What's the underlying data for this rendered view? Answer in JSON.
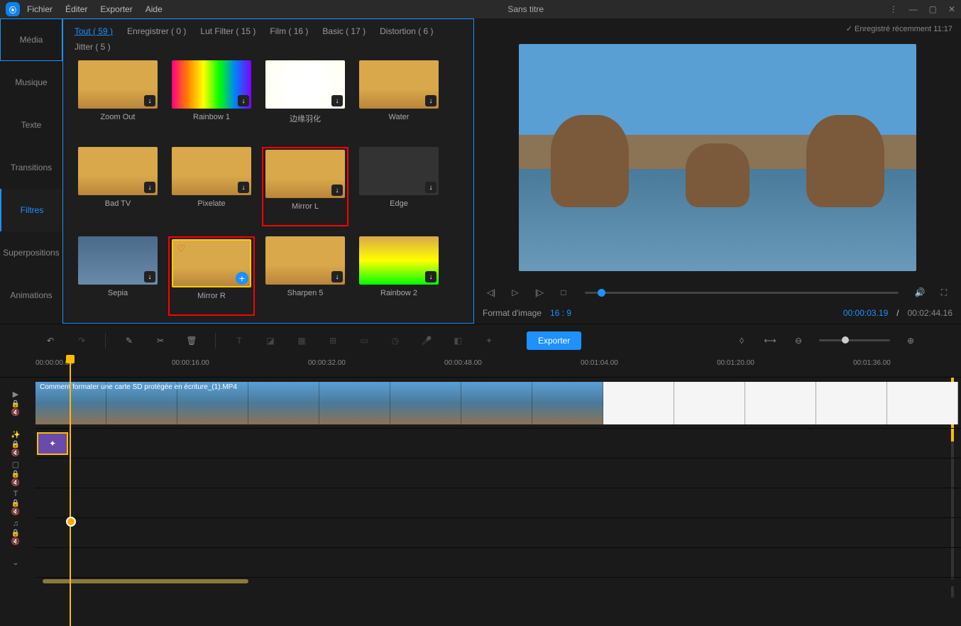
{
  "titlebar": {
    "menu": [
      "Fichier",
      "Éditer",
      "Exporter",
      "Aide"
    ],
    "title": "Sans titre"
  },
  "leftTabs": [
    "Média",
    "Musique",
    "Texte",
    "Transitions",
    "Filtres",
    "Superpositions",
    "Animations"
  ],
  "activeLeftTab": "Filtres",
  "filterCategories": [
    {
      "label": "Tout ( 59 )",
      "active": true
    },
    {
      "label": "Enregistrer ( 0 )",
      "active": false
    },
    {
      "label": "Lut Filter ( 15 )",
      "active": false
    },
    {
      "label": "Film ( 16 )",
      "active": false
    },
    {
      "label": "Basic ( 17 )",
      "active": false
    },
    {
      "label": "Distortion ( 6 )",
      "active": false
    },
    {
      "label": "Jitter ( 5 )",
      "active": false
    }
  ],
  "filters": [
    {
      "name": "Zoom Out",
      "style": "default",
      "dl": true
    },
    {
      "name": "Rainbow 1",
      "style": "rainbow",
      "dl": true
    },
    {
      "name": "边缘羽化",
      "style": "white",
      "dl": true
    },
    {
      "name": "Water",
      "style": "default",
      "dl": true
    },
    {
      "name": "Bad TV",
      "style": "default",
      "dl": true
    },
    {
      "name": "Pixelate",
      "style": "default",
      "dl": true
    },
    {
      "name": "Mirror L",
      "style": "default",
      "dl": true,
      "redbox": true
    },
    {
      "name": "Edge",
      "style": "dark",
      "dl": true
    },
    {
      "name": "Sepia",
      "style": "sepia",
      "dl": true
    },
    {
      "name": "Mirror R",
      "style": "default",
      "add": true,
      "heart": true,
      "redbox": true,
      "selected": true
    },
    {
      "name": "Sharpen 5",
      "style": "default",
      "dl": true
    },
    {
      "name": "Rainbow 2",
      "style": "green",
      "dl": true
    }
  ],
  "preview": {
    "savedStatus": "Enregistré récemment 11:17",
    "formatLabel": "Format d'image",
    "ratio": "16 : 9",
    "currentTime": "00:00:03.19",
    "duration": "00:02:44.16"
  },
  "toolbar": {
    "exportLabel": "Exporter"
  },
  "timeline": {
    "marks": [
      "00:00:00.00",
      "00:00:16.00",
      "00:00:32.00",
      "00:00:48.00",
      "00:01:04.00",
      "00:01:20.00",
      "00:01:36.00"
    ],
    "clipTitle": "Comment formater une carte SD protégée en écriture_(1).MP4"
  }
}
